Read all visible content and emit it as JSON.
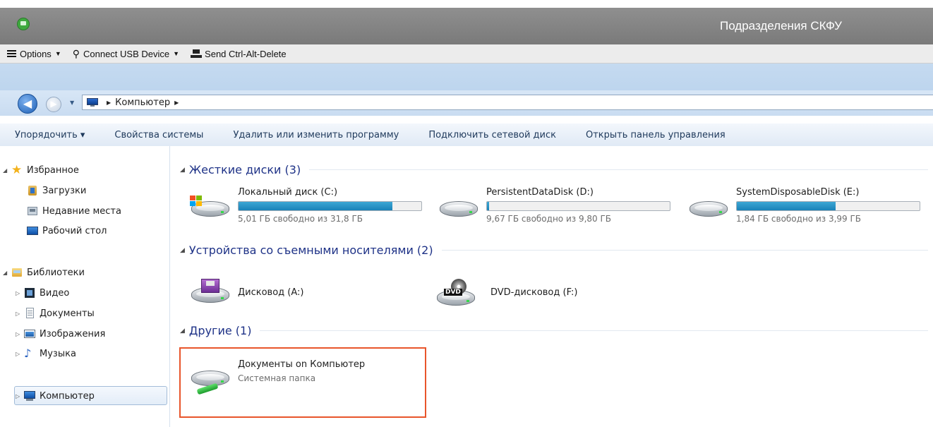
{
  "window": {
    "title": "Подразделения СКФУ"
  },
  "vm_toolbar": {
    "options_label": "Options",
    "usb_label": "Connect USB Device",
    "ctrl_alt_del_label": "Send Ctrl-Alt-Delete"
  },
  "address": {
    "path": "Компьютер"
  },
  "commands": [
    "Упорядочить ▾",
    "Свойства системы",
    "Удалить или изменить программу",
    "Подключить сетевой диск",
    "Открыть панель управления"
  ],
  "sidebar": {
    "favorites": {
      "label": "Избранное",
      "items": [
        "Загрузки",
        "Недавние места",
        "Рабочий стол"
      ]
    },
    "libraries": {
      "label": "Библиотеки",
      "items": [
        "Видео",
        "Документы",
        "Изображения",
        "Музыка"
      ]
    },
    "computer": "Компьютер"
  },
  "groups": {
    "hard_disks": {
      "title": "Жесткие диски (3)",
      "drives": [
        {
          "name": "Локальный диск (C:)",
          "free": "5,01 ГБ свободно из 31,8 ГБ",
          "used_fraction": 0.842
        },
        {
          "name": "PersistentDataDisk (D:)",
          "free": "9,67 ГБ свободно из 9,80 ГБ",
          "used_fraction": 0.013
        },
        {
          "name": "SystemDisposableDisk (E:)",
          "free": "1,84 ГБ свободно из 3,99 ГБ",
          "used_fraction": 0.539
        }
      ]
    },
    "removable": {
      "title": "Устройства со съемными носителями (2)",
      "devices": [
        {
          "name": "Дисковод (A:)"
        },
        {
          "name": "DVD-дисковод (F:)"
        }
      ]
    },
    "other": {
      "title": "Другие (1)",
      "items": [
        {
          "name": "Документы on Компьютер",
          "subtitle": "Системная папка"
        }
      ]
    }
  },
  "icons": {
    "dvd_badge": "DVD"
  },
  "colors": {
    "highlight": "#e8552b",
    "group_header": "#1e3287",
    "bar_fill": "#1a82b8"
  }
}
